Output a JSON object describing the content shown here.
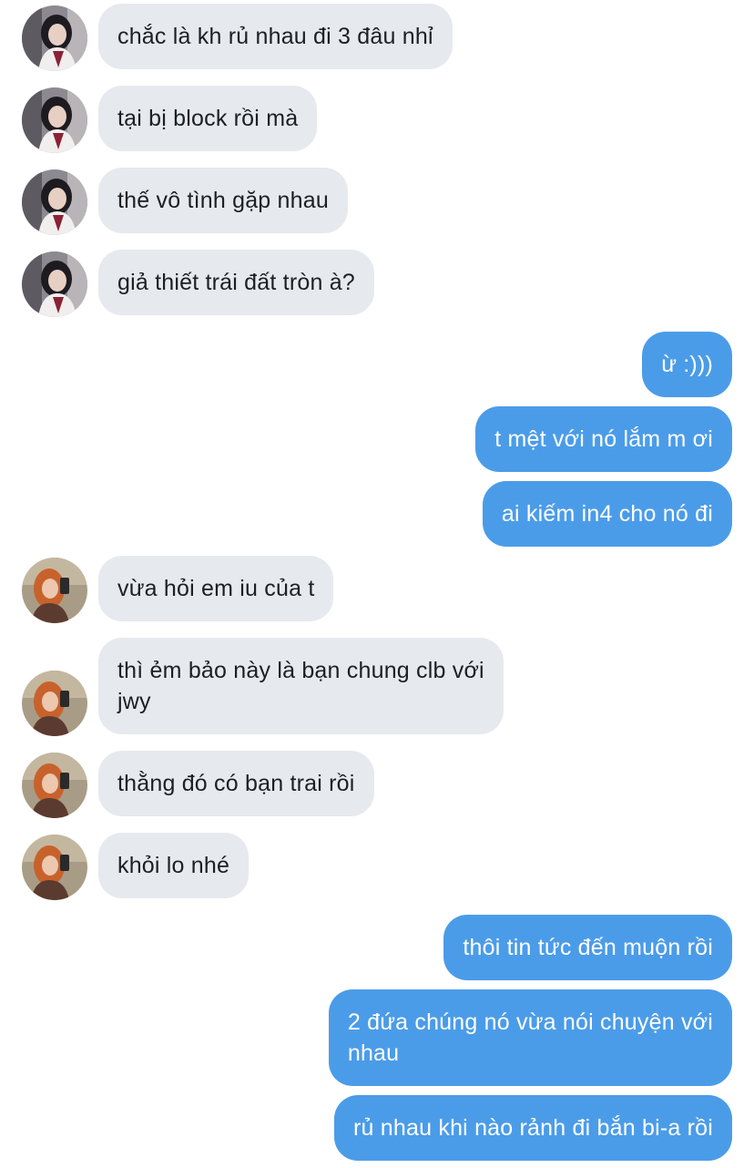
{
  "colors": {
    "incoming_bubble": "#e6e9ee",
    "incoming_text": "#1c1f24",
    "outgoing_bubble": "#4b9ce8",
    "outgoing_text": "#ffffff"
  },
  "contacts": {
    "first": {
      "avatar_icon": "user-avatar-dark-hair-icon"
    },
    "second": {
      "avatar_icon": "user-avatar-orange-hair-icon"
    }
  },
  "messages": [
    {
      "direction": "incoming",
      "sender": "first",
      "text": "chắc là kh rủ nhau đi 3 đâu nhỉ"
    },
    {
      "direction": "incoming",
      "sender": "first",
      "text": "tại bị block rồi mà"
    },
    {
      "direction": "incoming",
      "sender": "first",
      "text": "thế vô tình gặp nhau"
    },
    {
      "direction": "incoming",
      "sender": "first",
      "text": "giả thiết trái đất tròn à?"
    },
    {
      "direction": "outgoing",
      "text": "ừ :)))"
    },
    {
      "direction": "outgoing",
      "text": "t mệt với nó lắm m ơi"
    },
    {
      "direction": "outgoing",
      "text": "ai kiếm in4 cho nó đi"
    },
    {
      "direction": "incoming",
      "sender": "second",
      "text": "vừa hỏi em iu của t"
    },
    {
      "direction": "incoming",
      "sender": "second",
      "text": "thì ẻm bảo này là bạn chung clb với\njwy"
    },
    {
      "direction": "incoming",
      "sender": "second",
      "text": "thằng đó có bạn trai rồi"
    },
    {
      "direction": "incoming",
      "sender": "second",
      "text": "khỏi lo nhé"
    },
    {
      "direction": "outgoing",
      "text": "thôi tin tức đến muộn rồi"
    },
    {
      "direction": "outgoing",
      "text": "2 đứa chúng nó vừa nói chuyện với\nnhau"
    },
    {
      "direction": "outgoing",
      "text": "rủ nhau khi nào rảnh đi bắn bi-a rồi"
    }
  ]
}
